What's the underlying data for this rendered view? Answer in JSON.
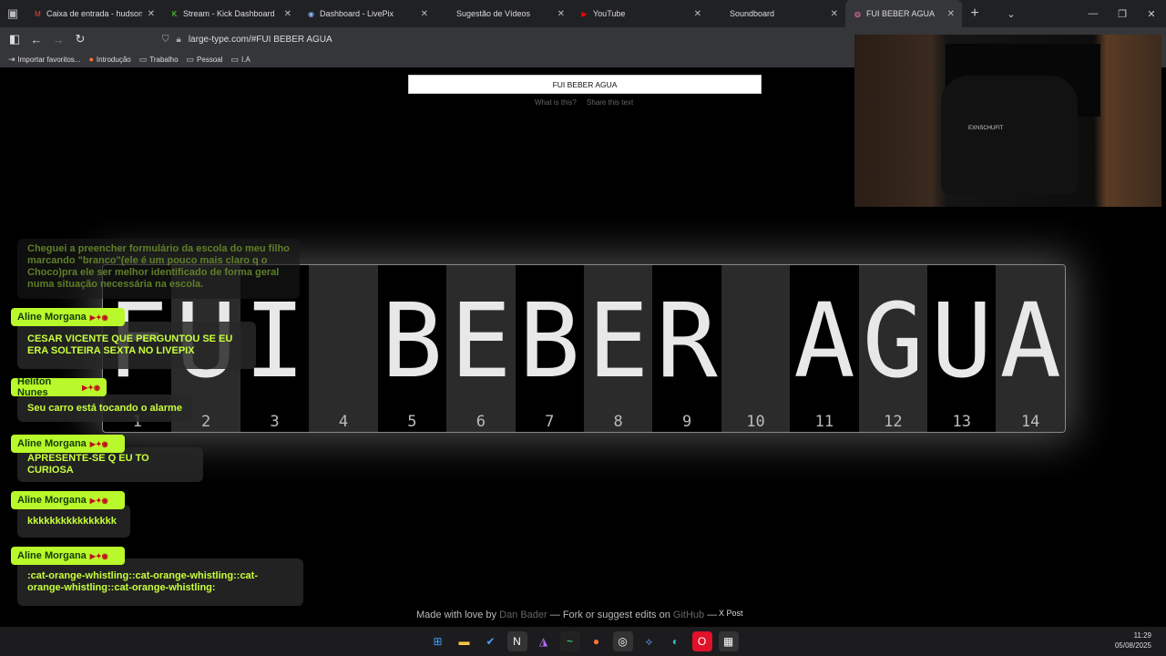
{
  "browser": {
    "tabs": [
      {
        "label": "Caixa de entrada - hudsonfabio",
        "fav": "M",
        "favcolor": "#ea4335",
        "icon": "gmail-icon"
      },
      {
        "label": "Stream - Kick Dashboard",
        "fav": "K",
        "favcolor": "#53fc18",
        "icon": "kick-icon"
      },
      {
        "label": "Dashboard - LivePix",
        "fav": "◉",
        "favcolor": "#8ab4f8",
        "icon": "livepix-icon"
      },
      {
        "label": "Sugestão de Vídeos",
        "fav": "",
        "favcolor": "",
        "icon": "blank-page-icon"
      },
      {
        "label": "YouTube",
        "fav": "▶",
        "favcolor": "#ff0000",
        "icon": "youtube-icon"
      },
      {
        "label": "Soundboard",
        "fav": "",
        "favcolor": "",
        "icon": "blank-page-icon"
      },
      {
        "label": "FUI BEBER AGUA",
        "fav": "◍",
        "favcolor": "#ff6fb0",
        "icon": "large-type-icon",
        "active": true
      }
    ],
    "url": "large-type.com/#FUI BEBER AGUA",
    "bookmarks": [
      {
        "label": "Importar favoritos...",
        "icon": "import-icon"
      },
      {
        "label": "Introdução",
        "icon": "firefox-icon"
      },
      {
        "label": "Trabalho",
        "icon": "folder-icon"
      },
      {
        "label": "Pessoal",
        "icon": "folder-icon"
      },
      {
        "label": "I.A",
        "icon": "folder-icon"
      }
    ]
  },
  "page": {
    "input_value": "FUI BEBER AGUA",
    "link_what": "What is this?",
    "link_share": "Share this text",
    "characters": [
      "F",
      "U",
      "I",
      " ",
      "B",
      "E",
      "B",
      "E",
      "R",
      " ",
      "A",
      "G",
      "U",
      "A"
    ],
    "numbers": [
      "1",
      "2",
      "3",
      "4",
      "5",
      "6",
      "7",
      "8",
      "9",
      "10",
      "11",
      "12",
      "13",
      "14"
    ],
    "footer": {
      "made": "Made with love by",
      "author": "Dan Bader",
      "mid": "— Fork or suggest edits on",
      "github": "GitHub",
      "dash": "—",
      "xpost": "X Post"
    }
  },
  "chat": {
    "faded_message": "Cheguei a preencher formulário da escola do meu filho marcando \"branco\"(ele é um pouco mais claro q o Choco)pra ele ser melhor identificado de forma geral numa situação necessária na escola.",
    "messages": [
      {
        "user": "Aline Morgana",
        "text": "CESAR VICENTE QUE PERGUNTOU SE EU ERA SOLTEIRA SEXTA NO LIVEPIX"
      },
      {
        "user": "Heliton Nunes",
        "text": "Seu carro está tocando o alarme"
      },
      {
        "user": "Aline Morgana",
        "text": "APRESENTE-SE Q EU TO CURIOSA"
      },
      {
        "user": "Aline Morgana",
        "text": "kkkkkkkkkkkkkkkk"
      },
      {
        "user": "Aline Morgana",
        "text": ":cat-orange-whistling::cat-orange-whistling::cat-orange-whistling::cat-orange-whistling:"
      }
    ]
  },
  "webcam": {
    "label": "EXNSCHUFIT"
  },
  "taskbar": {
    "icons": [
      "windows-icon",
      "file-explorer-icon",
      "todo-icon",
      "notion-icon",
      "affinity-icon",
      "terminal-icon",
      "firefox-icon",
      "obs-icon",
      "stream-tool-icon",
      "edge-icon",
      "opera-icon",
      "calendar-icon"
    ],
    "time": "11:29",
    "date": "05/08/2025"
  }
}
